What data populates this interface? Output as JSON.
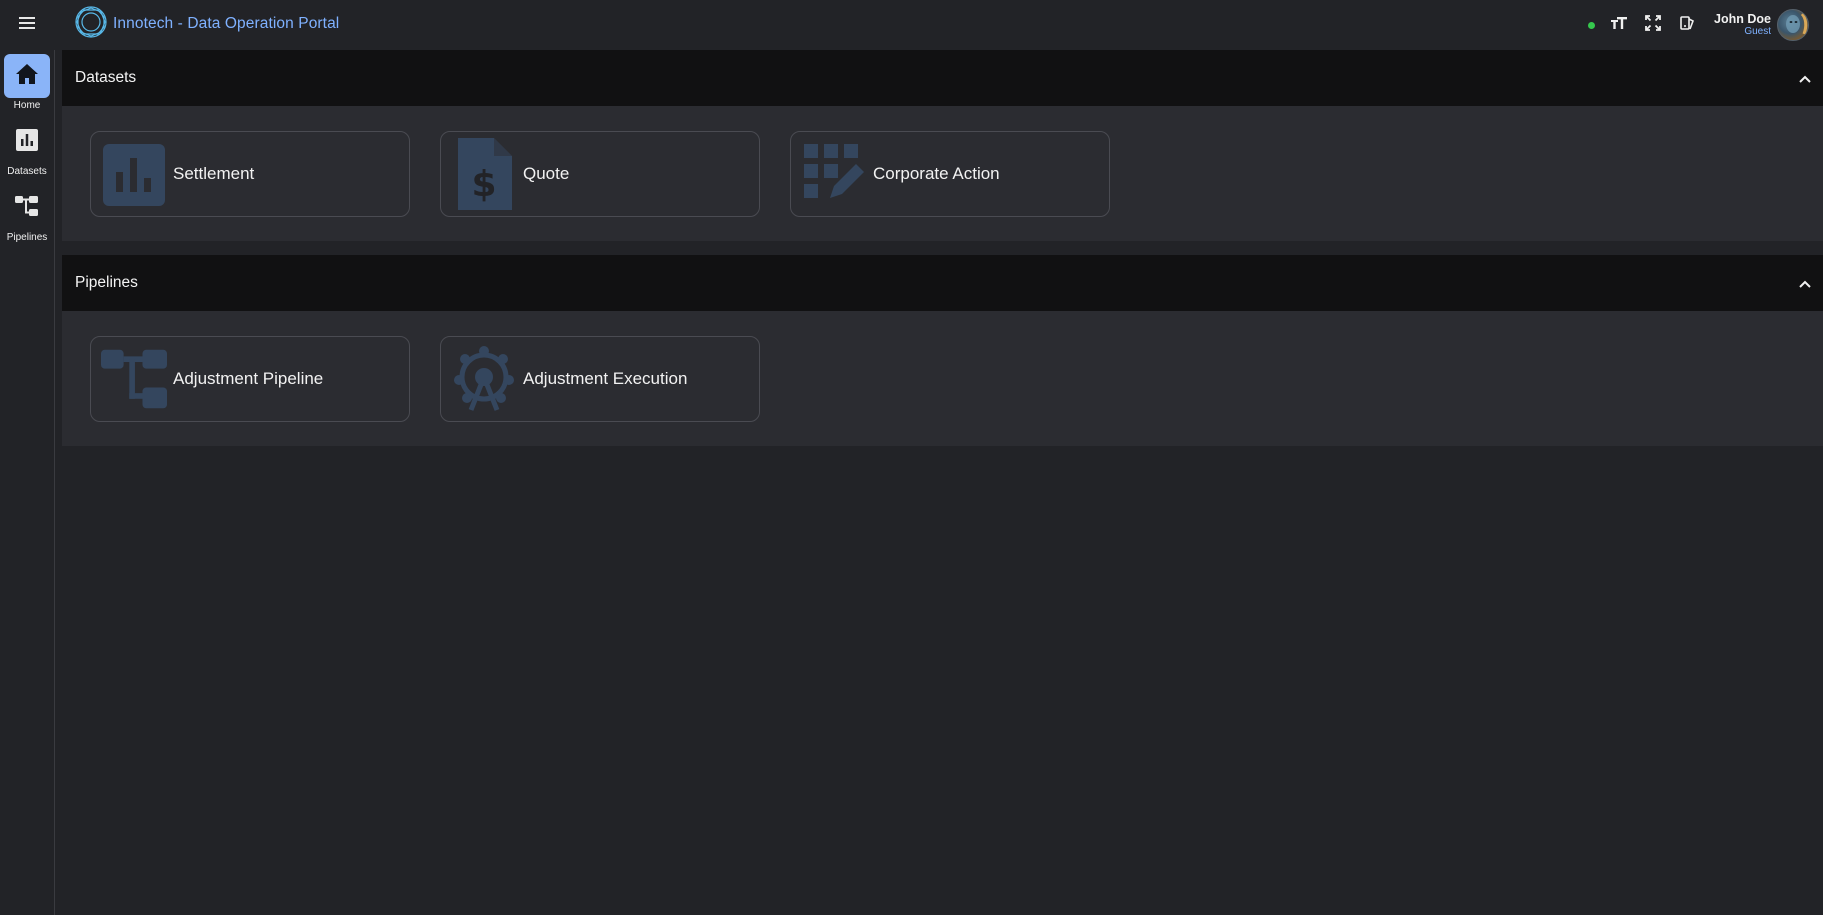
{
  "app": {
    "title": "Innotech - Data Operation Portal",
    "accent": "#7fb1ff",
    "status_color": "#35c84d"
  },
  "topbar": {
    "menu_icon": "hamburger-menu-icon",
    "tools": [
      {
        "name": "font-size-icon"
      },
      {
        "name": "fullscreen-icon"
      },
      {
        "name": "theme-toggle-icon"
      }
    ]
  },
  "user": {
    "name": "John Doe",
    "role": "Guest"
  },
  "rail": {
    "items": [
      {
        "label": "Home",
        "icon": "home-icon",
        "active": true
      },
      {
        "label": "Datasets",
        "icon": "bar-chart-icon",
        "active": false
      },
      {
        "label": "Pipelines",
        "icon": "pipeline-icon",
        "active": false
      }
    ]
  },
  "sections": [
    {
      "title": "Datasets",
      "cards": [
        {
          "label": "Settlement",
          "icon": "bar-chart-icon"
        },
        {
          "label": "Quote",
          "icon": "invoice-dollar-icon"
        },
        {
          "label": "Corporate Action",
          "icon": "grid-edit-icon"
        }
      ]
    },
    {
      "title": "Pipelines",
      "cards": [
        {
          "label": "Adjustment Pipeline",
          "icon": "pipeline-icon"
        },
        {
          "label": "Adjustment Execution",
          "icon": "ferris-wheel-icon"
        }
      ]
    }
  ],
  "colors": {
    "background": "#222327",
    "section_header": "#111112",
    "section_body": "#2b2c31",
    "card_icon": "#34465e",
    "rail_active": "#8ab4f8"
  }
}
